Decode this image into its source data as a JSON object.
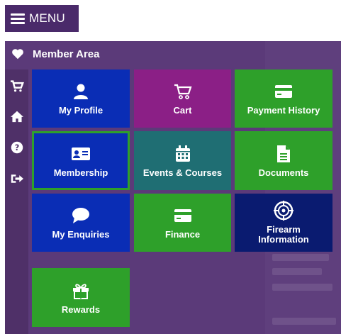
{
  "menu": {
    "label": "MENU"
  },
  "header": {
    "title": "Member Area"
  },
  "sidebar": {
    "icons": [
      "cart-icon",
      "home-icon",
      "help-icon",
      "logout-icon"
    ]
  },
  "tiles": [
    {
      "label": "My Profile",
      "icon": "user-icon",
      "color": "#0a2db5"
    },
    {
      "label": "Cart",
      "icon": "cart-icon",
      "color": "#8b1f86"
    },
    {
      "label": "Payment History",
      "icon": "credit-card-icon",
      "color": "#2ea02a"
    },
    {
      "label": "Membership",
      "icon": "id-card-icon",
      "color": "#0a2db5"
    },
    {
      "label": "Events & Courses",
      "icon": "calendar-icon",
      "color": "#1f6e73"
    },
    {
      "label": "Documents",
      "icon": "document-icon",
      "color": "#2ea02a"
    },
    {
      "label": "My Enquiries",
      "icon": "chat-icon",
      "color": "#0a2db5"
    },
    {
      "label": "Finance",
      "icon": "credit-card-icon",
      "color": "#2ea02a"
    },
    {
      "label": "Firearm Information",
      "icon": "crosshair-icon",
      "color": "#0a1b70"
    },
    {
      "label": "Rewards",
      "icon": "gift-icon",
      "color": "#2ea02a"
    }
  ]
}
